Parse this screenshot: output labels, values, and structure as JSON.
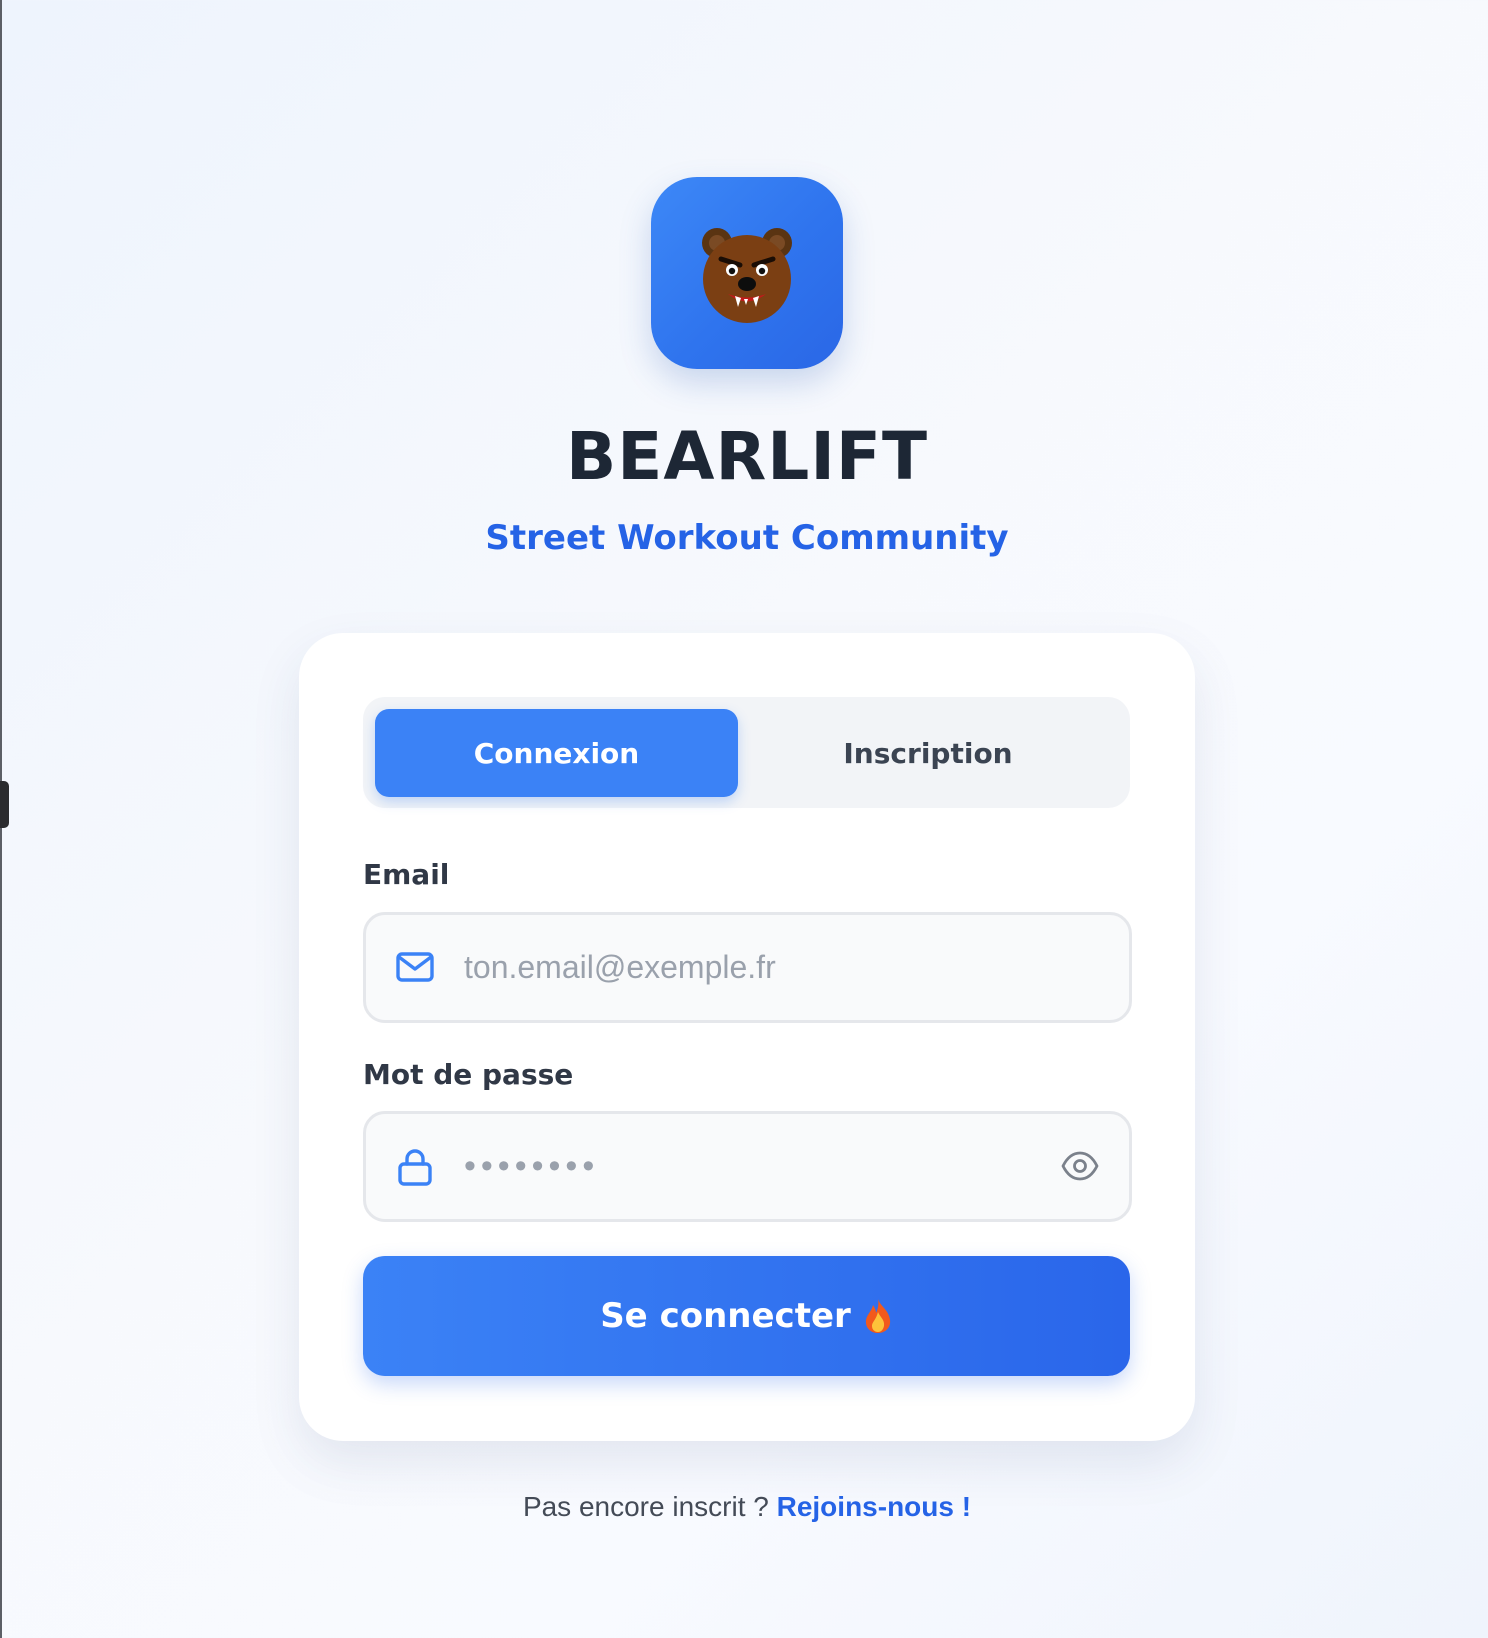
{
  "app": {
    "title": "BEARLIFT",
    "subtitle": "Street Workout Community",
    "logo_icon": "angry-bear-icon"
  },
  "tabs": {
    "login_label": "Connexion",
    "signup_label": "Inscription",
    "active": "login"
  },
  "form": {
    "email_label": "Email",
    "email_placeholder": "ton.email@exemple.fr",
    "email_value": "",
    "email_icon": "mail-icon",
    "password_label": "Mot de passe",
    "password_placeholder": "••••••••",
    "password_value": "",
    "password_icon": "lock-icon",
    "toggle_visibility_icon": "eye-icon",
    "submit_label": "Se connecter",
    "submit_icon": "fire-icon"
  },
  "footer": {
    "prompt": "Pas encore inscrit ? ",
    "link_label": "Rejoins-nous !"
  },
  "colors": {
    "primary": "#3b82f6",
    "primary_dark": "#2563eb",
    "title": "#1d2735",
    "subtitle": "#2563e6"
  }
}
